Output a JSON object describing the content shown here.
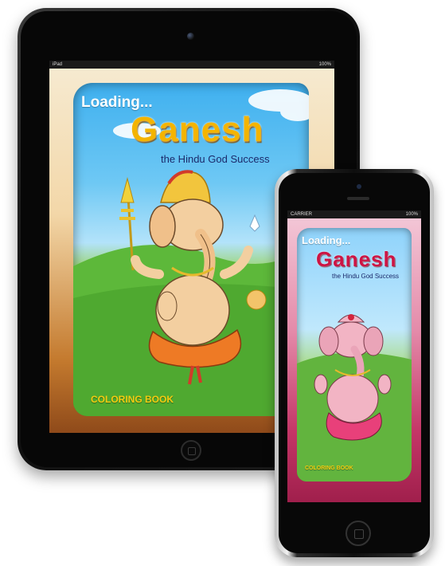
{
  "ipad": {
    "status": {
      "left": "iPad",
      "right": "100%"
    },
    "app": {
      "loading": "Loading...",
      "title": "Ganesh",
      "subtitle": "the Hindu God Success",
      "footer": "COLORING BOOK"
    }
  },
  "iphone": {
    "status": {
      "left": "CARRIER",
      "right": "100%"
    },
    "app": {
      "loading": "Loading...",
      "title": "Ganesh",
      "subtitle": "the Hindu God Success",
      "footer": "COLORING BOOK"
    }
  },
  "colors": {
    "title_fill": "#f4b400",
    "subtitle": "#1b2a6b",
    "footer": "#f4cc10",
    "ipad_border": "#c47a2e",
    "iphone_border": "#c43667",
    "iphone_title": "#cc1444"
  }
}
